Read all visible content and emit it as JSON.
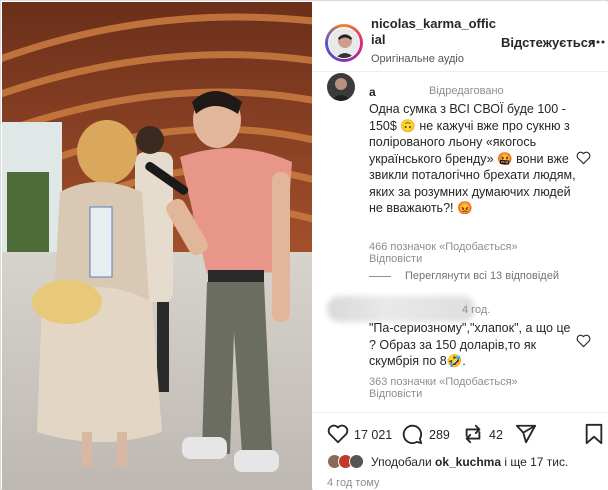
{
  "post": {
    "username": "nicolas_karma_official",
    "follow_label": "Відстежується",
    "audio_label": "Оригінальне аудіо"
  },
  "comments": [
    {
      "name": "a",
      "edited_label": "Відредаговано",
      "text": "Одна сумка з ВСІ СВОЇ буде 100 - 150$ 🙃 не кажучі вже про сукню з полірованого льону «якогось українського бренду» 🤬 вони вже звикли поталогічно брехати людям, яких за розумних думаючих людей не вважають?! 😡",
      "likes_label": "466 позначок «Подобається»",
      "reply_label": "Відповісти",
      "view_replies_label": "Переглянути всі 13 відповідей"
    },
    {
      "time": "4 год.",
      "text": "\"Па-сериозному\",\"хлапок\", а що це ? Образ за 150 доларів,то як скумбрія по 8🤣.",
      "likes_label": "363 позначки «Подобається»",
      "reply_label": "Відповісти"
    }
  ],
  "actions": {
    "likes_count": "17 021",
    "comments_count": "289",
    "reposts_count": "42"
  },
  "liked_by": {
    "prefix": "Уподобали",
    "user": "ok_kuchma",
    "suffix": "і ще 17 тис."
  },
  "posted_ago": "4 год тому",
  "colors": {
    "text": "#262626",
    "muted": "#8e8e8e",
    "border": "#dbdbdb"
  },
  "icons": [
    "heart-icon",
    "comment-icon",
    "repost-icon",
    "share-icon",
    "bookmark-icon",
    "more-icon"
  ]
}
